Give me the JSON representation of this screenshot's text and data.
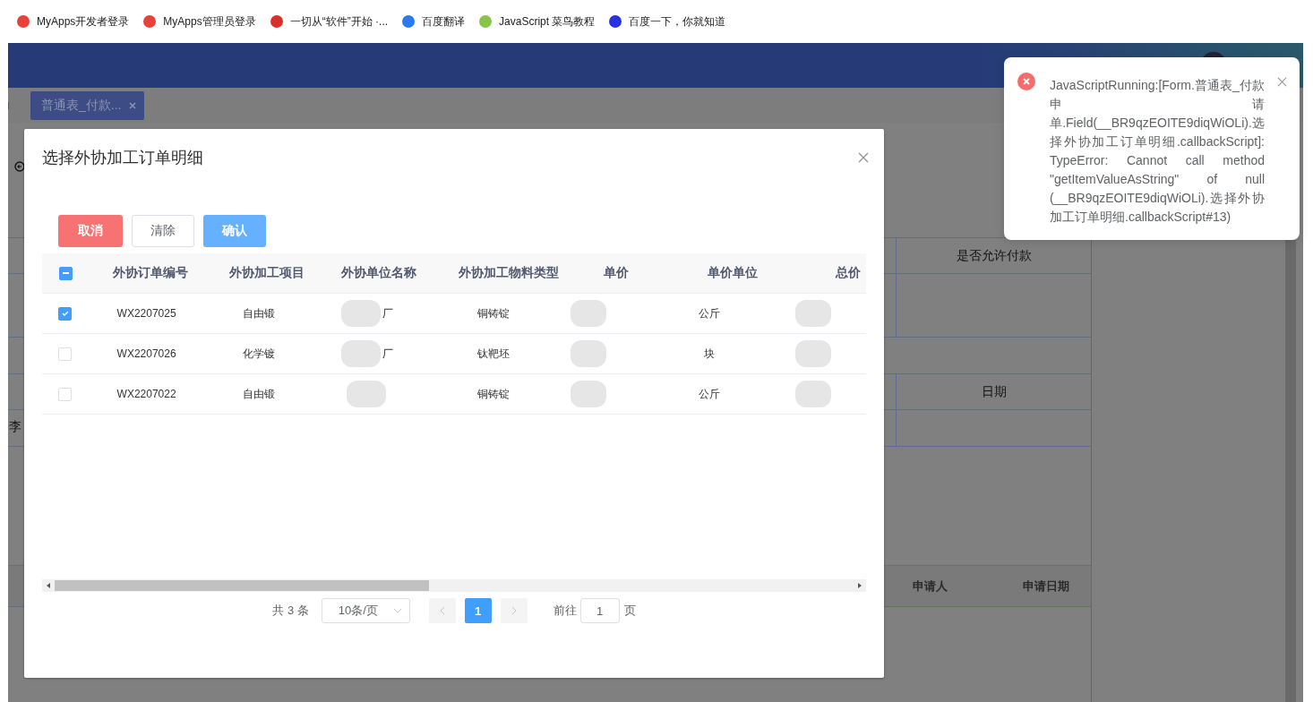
{
  "bookmarks": [
    {
      "label": "MyApps开发者登录",
      "color": "#e8413a"
    },
    {
      "label": "MyApps管理员登录",
      "color": "#e8413a"
    },
    {
      "label": "一切从“软件”开始 ·...",
      "color": "#d9302b"
    },
    {
      "label": "百度翻译",
      "color": "#2b7bf0"
    },
    {
      "label": "JavaScript  菜鸟教程",
      "color": "#8bc34a"
    },
    {
      "label": "百度一下，你就知道",
      "color": "#2932e1"
    }
  ],
  "tabs": [
    {
      "label": "普通表_付款...",
      "selected": true
    }
  ],
  "background_form": {
    "header_1": "是否允许付款",
    "header_2": "日期",
    "cell": "李",
    "column_1": "申请人",
    "column_2": "申请日期"
  },
  "dialog": {
    "title": "选择外协加工订单明细",
    "buttons": [
      {
        "label": "取消",
        "kind": "danger"
      },
      {
        "label": "清除",
        "kind": "plain"
      },
      {
        "label": "确认",
        "kind": "primary"
      }
    ],
    "table": {
      "select_all": {
        "indeterminate": true
      },
      "columns": [
        "外协订单编号",
        "外协加工项目",
        "外协单位名称",
        "外协加工物料类型",
        "单价",
        "单价单位",
        "总价"
      ],
      "rows": [
        {
          "checked": true,
          "cells": [
            "WX2207025",
            "自由锻",
            "厂",
            "铜铸锭",
            "",
            "公斤",
            ""
          ]
        },
        {
          "checked": false,
          "cells": [
            "WX2207026",
            "化学镀",
            "厂",
            "钛靶坯",
            "",
            "块",
            ""
          ]
        },
        {
          "checked": false,
          "cells": [
            "WX2207022",
            "自由锻",
            "",
            "铜铸锭",
            "",
            "公斤",
            ""
          ]
        }
      ]
    },
    "pagination": {
      "total": "共 3 条",
      "page_size": "10条/页",
      "pages": [
        {
          "label": "1",
          "selected": true
        }
      ],
      "goto_label": "前往",
      "goto_value": "1",
      "goto_suffix": "页"
    }
  },
  "notification": {
    "message": "JavaScriptRunning:[Form.普通表_付款申请单.Field(__BR9qzEOITE9diqWiOLi).选择外协加工订单明细.callbackScript]: TypeError: Cannot call method \"getItemValueAsString\" of null (__BR9qzEOITE9diqWiOLi).选择外协加工订单明细.callbackScript#13)"
  }
}
